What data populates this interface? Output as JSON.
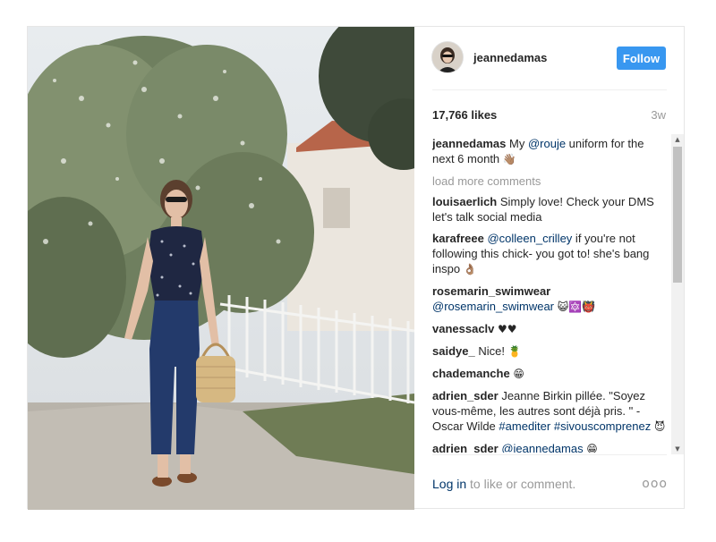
{
  "post": {
    "username": "jeannedamas",
    "follow_label": "Follow",
    "likes": "17,766 likes",
    "age": "3w",
    "caption": {
      "user": "jeannedamas",
      "text_before": "My ",
      "mention": "@rouje",
      "text_after": " uniform for the next 6 month",
      "emoji": "👋🏽"
    },
    "load_more_label": "load more comments",
    "comments": [
      {
        "user": "louisaerlich",
        "text": "Simply love! Check your DMS let's talk social media"
      },
      {
        "user": "karafreee",
        "mention": "@colleen_crilley",
        "text": " if you're not following this chick- you got to! she's bang inspo",
        "emoji": "👌🏽"
      },
      {
        "user": "rosemarin_swimwear",
        "mention": "@rosemarin_swimwear",
        "emoji": "😺🔯👹"
      },
      {
        "user": "vanessaclv",
        "emoji": "♥♥"
      },
      {
        "user": "saidye_",
        "text": "Nice!",
        "emoji": "🍍"
      },
      {
        "user": "chademanche",
        "emoji": "😁"
      },
      {
        "user": "adrien_sder",
        "text": "Jeanne Birkin pillée. \"Soyez vous-même, les autres sont déjà pris. \" - Oscar Wilde",
        "hashtag1": "#amediter",
        "hashtag2": "#sivouscomprenez",
        "emoji": "😈"
      },
      {
        "user": "adrien_sder",
        "mention": "@jeannedamas",
        "emoji": "😁"
      }
    ],
    "footer": {
      "login_label": "Log in",
      "text": " to like or comment.",
      "more_label": "ooo"
    }
  }
}
